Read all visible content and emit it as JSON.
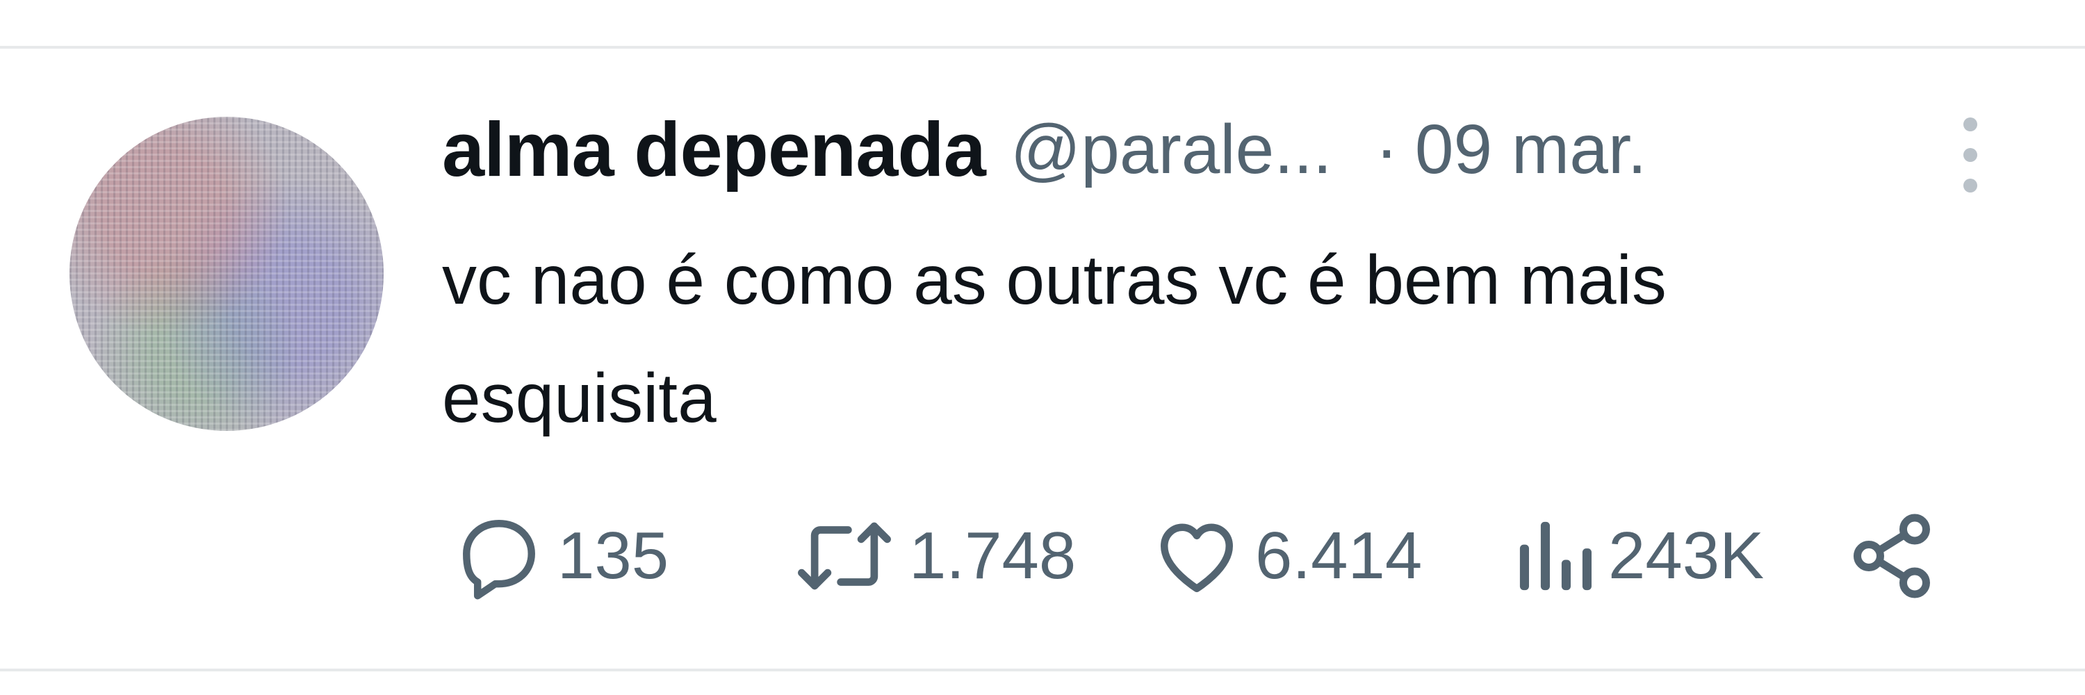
{
  "tweet": {
    "author": {
      "display_name": "alma depenada",
      "handle": "@parale...",
      "avatar": "avatar-image"
    },
    "separator": "·",
    "date": "09 mar.",
    "text_lines": [
      "vc nao é como as outras vc é bem mais",
      "esquisita"
    ],
    "actions": {
      "replies": {
        "icon": "reply-icon",
        "count": "135"
      },
      "retweets": {
        "icon": "retweet-icon",
        "count": "1.748"
      },
      "likes": {
        "icon": "heart-icon",
        "count": "6.414"
      },
      "views": {
        "icon": "views-icon",
        "count": "243K"
      },
      "share": {
        "icon": "share-icon"
      }
    },
    "more": {
      "icon": "more-vertical-icon"
    }
  },
  "colors": {
    "text_primary": "#0f1419",
    "text_secondary": "#536471",
    "divider": "#e7e9ea"
  }
}
